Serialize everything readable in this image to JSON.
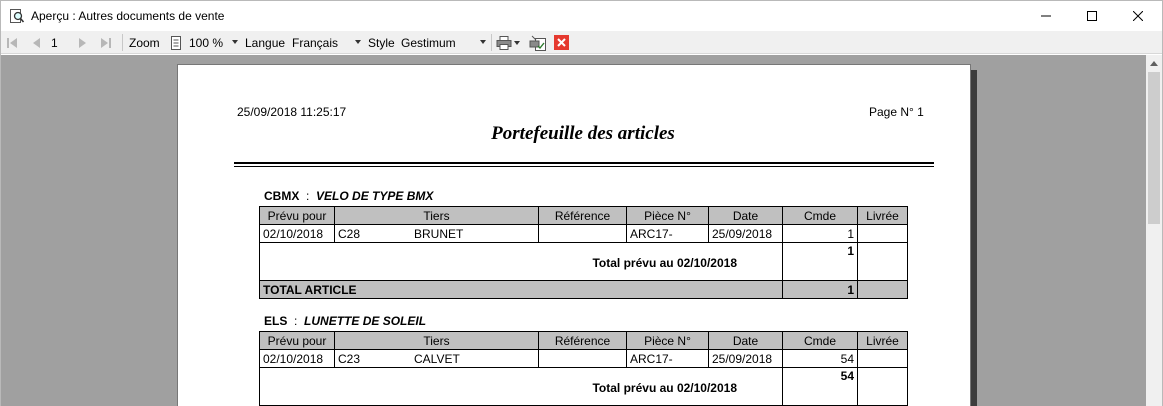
{
  "window": {
    "title": "Aperçu : Autres documents de vente"
  },
  "toolbar": {
    "page_number": "1",
    "zoom_label": "Zoom",
    "zoom_value": "100 %",
    "language_label": "Langue",
    "language_value": "Français",
    "style_label": "Style",
    "style_value": "Gestimum"
  },
  "report": {
    "timestamp": "25/09/2018 11:25:17",
    "page_label": "Page N° 1",
    "title": "Portefeuille des articles",
    "columns": [
      "Prévu pour",
      "Tiers",
      "Référence",
      "Pièce N°",
      "Date",
      "Cmde",
      "Livrée"
    ],
    "articles": [
      {
        "code": "CBMX",
        "separator": ":",
        "description": "VELO DE TYPE BMX",
        "row": {
          "prevu_pour": "02/10/2018",
          "tiers_code": "C28",
          "tiers_name": "BRUNET",
          "reference": "",
          "piece": "ARC17-",
          "date": "25/09/2018",
          "cmde": "1",
          "livree": ""
        },
        "total_label": "Total prévu au 02/10/2018",
        "total_value": "1",
        "grand_label": "TOTAL ARTICLE",
        "grand_value": "1"
      },
      {
        "code": "ELS",
        "separator": ":",
        "description": "LUNETTE DE SOLEIL",
        "row": {
          "prevu_pour": "02/10/2018",
          "tiers_code": "C23",
          "tiers_name": "CALVET",
          "reference": "",
          "piece": "ARC17-",
          "date": "25/09/2018",
          "cmde": "54",
          "livree": ""
        },
        "total_label": "Total prévu au 02/10/2018",
        "total_value": "54"
      }
    ]
  },
  "icons": {
    "app": "magnifier-document-icon",
    "print": "printer-icon",
    "export": "export-document-icon",
    "close_preview": "close-red-icon"
  },
  "colors": {
    "close_preview_red": "#e5392f",
    "header_cell_gray": "#c0c0c0",
    "preview_background": "#a0a0a0"
  }
}
